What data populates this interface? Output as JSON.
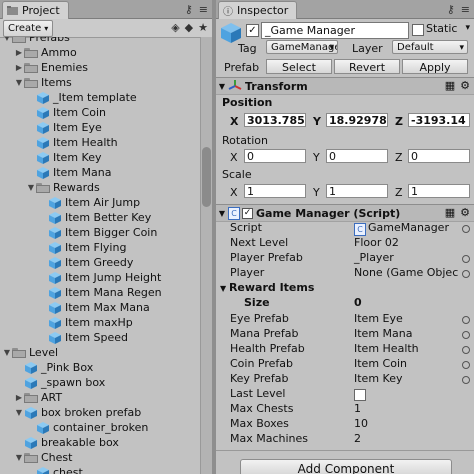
{
  "project": {
    "tab_title": "Project",
    "create_label": "Create",
    "tree": [
      {
        "label": "Prefabs",
        "kind": "folder",
        "depth": 0,
        "open": true
      },
      {
        "label": "Ammo",
        "kind": "folder",
        "depth": 1,
        "open": false
      },
      {
        "label": "Enemies",
        "kind": "folder",
        "depth": 1,
        "open": false
      },
      {
        "label": "Items",
        "kind": "folder",
        "depth": 1,
        "open": true
      },
      {
        "label": "_Item template",
        "kind": "prefab",
        "depth": 2
      },
      {
        "label": "Item Coin",
        "kind": "prefab",
        "depth": 2
      },
      {
        "label": "Item Eye",
        "kind": "prefab",
        "depth": 2
      },
      {
        "label": "Item Health",
        "kind": "prefab",
        "depth": 2
      },
      {
        "label": "Item Key",
        "kind": "prefab",
        "depth": 2
      },
      {
        "label": "Item Mana",
        "kind": "prefab",
        "depth": 2
      },
      {
        "label": "Rewards",
        "kind": "folder",
        "depth": 2,
        "open": true
      },
      {
        "label": "Item Air Jump",
        "kind": "prefab",
        "depth": 3
      },
      {
        "label": "Item Better Key",
        "kind": "prefab",
        "depth": 3
      },
      {
        "label": "Item Bigger Coin",
        "kind": "prefab",
        "depth": 3
      },
      {
        "label": "Item Flying",
        "kind": "prefab",
        "depth": 3
      },
      {
        "label": "Item Greedy",
        "kind": "prefab",
        "depth": 3
      },
      {
        "label": "Item Jump Height",
        "kind": "prefab",
        "depth": 3
      },
      {
        "label": "Item Mana Regen",
        "kind": "prefab",
        "depth": 3
      },
      {
        "label": "Item Max Mana",
        "kind": "prefab",
        "depth": 3
      },
      {
        "label": "Item maxHp",
        "kind": "prefab",
        "depth": 3
      },
      {
        "label": "Item Speed",
        "kind": "prefab",
        "depth": 3
      },
      {
        "label": "Level",
        "kind": "folder",
        "depth": 0,
        "open": true
      },
      {
        "label": "_Pink Box",
        "kind": "prefab",
        "depth": 1
      },
      {
        "label": "_spawn box",
        "kind": "prefab",
        "depth": 1
      },
      {
        "label": "ART",
        "kind": "folder",
        "depth": 1,
        "open": false
      },
      {
        "label": "box broken prefab",
        "kind": "prefab",
        "depth": 1,
        "open": true
      },
      {
        "label": "container_broken",
        "kind": "prefab",
        "depth": 2
      },
      {
        "label": "breakable box",
        "kind": "prefab",
        "depth": 1
      },
      {
        "label": "Chest",
        "kind": "folder",
        "depth": 1,
        "open": true
      },
      {
        "label": "chest",
        "kind": "prefab",
        "depth": 2
      }
    ]
  },
  "inspector": {
    "tab_title": "Inspector",
    "object_name": "_Game Manager",
    "static_label": "Static",
    "tag_label": "Tag",
    "tag_value": "GameManager",
    "layer_label": "Layer",
    "layer_value": "Default",
    "prefab_label": "Prefab",
    "prefab_buttons": {
      "select": "Select",
      "revert": "Revert",
      "apply": "Apply"
    },
    "transform": {
      "title": "Transform",
      "position_label": "Position",
      "rotation_label": "Rotation",
      "scale_label": "Scale",
      "axis_x": "X",
      "axis_y": "Y",
      "axis_z": "Z",
      "position": {
        "x": "3013.785",
        "y": "18.92978",
        "z": "-3193.14"
      },
      "rotation": {
        "x": "0",
        "y": "0",
        "z": "0"
      },
      "scale": {
        "x": "1",
        "y": "1",
        "z": "1"
      }
    },
    "game_manager": {
      "title": "Game Manager (Script)",
      "script_label": "Script",
      "script_value": "GameManager",
      "next_level_label": "Next Level",
      "next_level_value": "Floor 02",
      "player_prefab_label": "Player Prefab",
      "player_prefab_value": "_Player",
      "player_label": "Player",
      "player_value": "None (Game Object)",
      "reward_items_label": "Reward Items",
      "size_label": "Size",
      "size_value": "0",
      "eye_prefab_label": "Eye Prefab",
      "eye_prefab_value": "Item Eye",
      "mana_prefab_label": "Mana Prefab",
      "mana_prefab_value": "Item Mana",
      "health_prefab_label": "Health Prefab",
      "health_prefab_value": "Item Health",
      "coin_prefab_label": "Coin Prefab",
      "coin_prefab_value": "Item Coin",
      "key_prefab_label": "Key Prefab",
      "key_prefab_value": "Item Key",
      "last_level_label": "Last Level",
      "max_chests_label": "Max Chests",
      "max_chests_value": "1",
      "max_boxes_label": "Max Boxes",
      "max_boxes_value": "10",
      "max_machines_label": "Max Machines",
      "max_machines_value": "2"
    },
    "add_component_label": "Add Component"
  },
  "colors": {
    "prefab_cube": "#4fa3e0",
    "prefab_cube_dark": "#2b79b8",
    "folder": "#a9a9a9"
  }
}
